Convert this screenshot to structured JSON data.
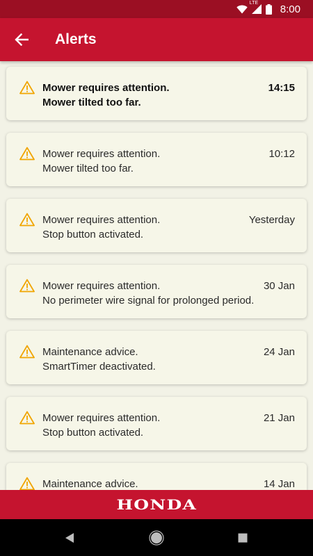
{
  "status_bar": {
    "network": "LTE",
    "time": "8:00",
    "icons": [
      "wifi-icon",
      "cell-signal-icon",
      "battery-icon"
    ]
  },
  "app_bar": {
    "title": "Alerts",
    "back_icon": "arrow-left-icon"
  },
  "alerts": [
    {
      "title": "Mower requires attention.",
      "message": "Mower tilted too far.",
      "time": "14:15",
      "unread": true
    },
    {
      "title": "Mower requires attention.",
      "message": "Mower tilted too far.",
      "time": "10:12",
      "unread": false
    },
    {
      "title": "Mower requires attention.",
      "message": "Stop button activated.",
      "time": "Yesterday",
      "unread": false
    },
    {
      "title": "Mower requires attention.",
      "message": "No perimeter wire signal for prolonged period.",
      "time": "30 Jan",
      "unread": false
    },
    {
      "title": "Maintenance advice.",
      "message": "SmartTimer deactivated.",
      "time": "24 Jan",
      "unread": false
    },
    {
      "title": "Mower requires attention.",
      "message": "Stop button activated.",
      "time": "21 Jan",
      "unread": false
    },
    {
      "title": "Maintenance advice.",
      "message": "",
      "time": "14 Jan",
      "unread": false
    }
  ],
  "footer": {
    "logo_text": "HONDA"
  },
  "nav_bar": {
    "icons": [
      "back-triangle-icon",
      "home-circle-icon",
      "recents-square-icon"
    ]
  },
  "colors": {
    "brand_red": "#c5142f",
    "status_bar_red": "#9b0f23",
    "card_background": "#f6f6e8",
    "warning_icon": "#f0a500"
  }
}
